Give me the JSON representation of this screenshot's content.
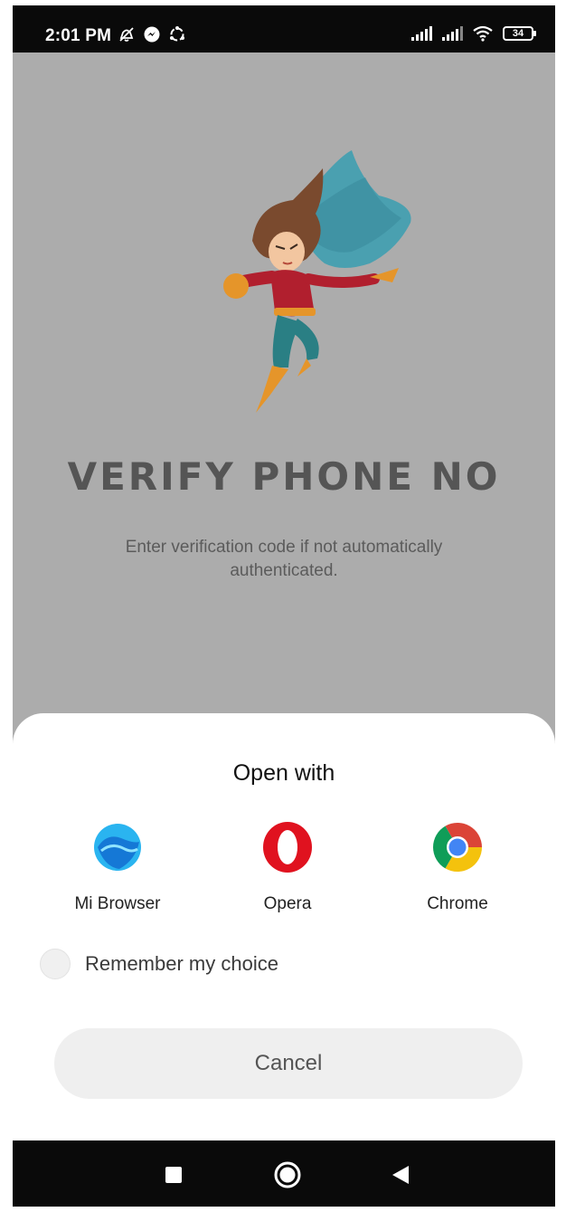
{
  "status_bar": {
    "time": "2:01 PM",
    "battery": "34",
    "left_icons": [
      "mute-icon",
      "messenger-icon",
      "sync-icon"
    ],
    "right_icons": [
      "signal-icon",
      "signal-icon",
      "wifi-icon",
      "battery-icon"
    ]
  },
  "app": {
    "title": "VERIFY PHONE NO",
    "subtitle": "Enter verification code if not automatically authenticated.",
    "illustration": "superhero-woman-illustration",
    "background_color": "#acacac"
  },
  "sheet": {
    "title": "Open with",
    "apps": [
      {
        "label": "Mi Browser",
        "icon": "mi-browser-icon"
      },
      {
        "label": "Opera",
        "icon": "opera-icon"
      },
      {
        "label": "Chrome",
        "icon": "chrome-icon"
      }
    ],
    "remember_label": "Remember my choice",
    "remember_checked": false,
    "cancel_label": "Cancel"
  },
  "nav_bar": {
    "icons": [
      "recents-icon",
      "home-icon",
      "back-icon"
    ]
  },
  "colors": {
    "opera_red": "#e0121f",
    "mi_browser_blue": "#1d8fe8",
    "chrome_red": "#db4437",
    "chrome_yellow": "#f4c20d",
    "chrome_green": "#0f9d58",
    "chrome_blue": "#4285f4"
  }
}
